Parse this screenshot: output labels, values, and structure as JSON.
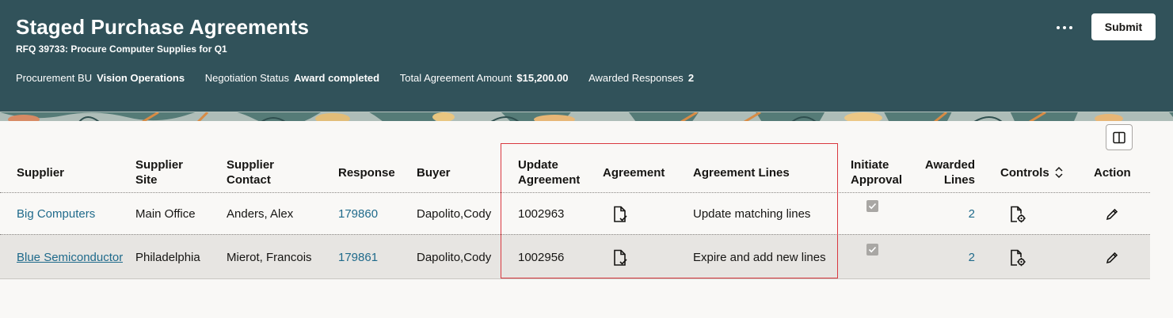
{
  "header": {
    "title": "Staged Purchase Agreements",
    "subtitle": "RFQ 39733: Procure Computer Supplies for Q1",
    "meta": [
      {
        "label": "Procurement BU",
        "value": "Vision Operations"
      },
      {
        "label": "Negotiation Status",
        "value": "Award completed"
      },
      {
        "label": "Total Agreement Amount",
        "value": "$15,200.00"
      },
      {
        "label": "Awarded Responses",
        "value": "2"
      }
    ],
    "submit_label": "Submit"
  },
  "colors": {
    "header_bg": "#31525a",
    "link": "#1f6a8b",
    "highlight": "#d9383f",
    "selected_row": "#e7e5e2"
  },
  "table": {
    "columns": {
      "supplier": "Supplier",
      "supplier_site_1": "Supplier",
      "supplier_site_2": "Site",
      "supplier_contact_1": "Supplier",
      "supplier_contact_2": "Contact",
      "response": "Response",
      "buyer": "Buyer",
      "update_agreement_1": "Update",
      "update_agreement_2": "Agreement",
      "agreement": "Agreement",
      "agreement_lines": "Agreement Lines",
      "initiate_approval_1": "Initiate",
      "initiate_approval_2": "Approval",
      "awarded_lines_1": "Awarded",
      "awarded_lines_2": "Lines",
      "controls": "Controls",
      "action": "Action"
    },
    "rows": [
      {
        "supplier": "Big Computers",
        "site": "Main Office",
        "contact": "Anders, Alex",
        "response": "179860",
        "buyer": "Dapolito,Cody",
        "update_agreement": "1002963",
        "agreement_lines": "Update matching lines",
        "initiate_approval": true,
        "awarded_lines": "2"
      },
      {
        "supplier": "Blue Semiconductor",
        "site": "Philadelphia",
        "contact": "Mierot, Francois",
        "response": "179861",
        "buyer": "Dapolito,Cody",
        "update_agreement": "1002956",
        "agreement_lines": "Expire and add new lines",
        "initiate_approval": true,
        "awarded_lines": "2"
      }
    ]
  },
  "icons": {
    "more": "more-horizontal-icon",
    "panel": "column-panel-icon",
    "agreement": "document-check-icon",
    "controls": "document-gear-icon",
    "action": "pencil-icon",
    "sort": "sort-icon"
  }
}
